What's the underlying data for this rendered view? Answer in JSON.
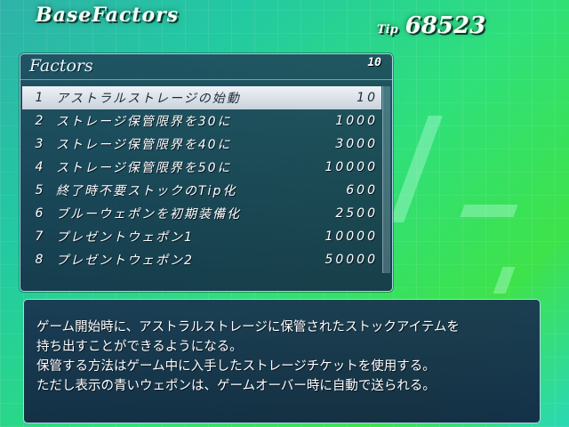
{
  "header": {
    "title": "BaseFactors",
    "tip_label": "Tip",
    "tip_value": "68523"
  },
  "factors_panel": {
    "title": "Factors",
    "count": "10",
    "selected_index": 0,
    "items": [
      {
        "num": "1",
        "name": "アストラルストレージの始動",
        "cost": "10"
      },
      {
        "num": "2",
        "name": "ストレージ保管限界を30に",
        "cost": "1000"
      },
      {
        "num": "3",
        "name": "ストレージ保管限界を40に",
        "cost": "3000"
      },
      {
        "num": "4",
        "name": "ストレージ保管限界を50に",
        "cost": "10000"
      },
      {
        "num": "5",
        "name": "終了時不要ストックのTip化",
        "cost": "600"
      },
      {
        "num": "6",
        "name": "ブルーウェポンを初期装備化",
        "cost": "2500"
      },
      {
        "num": "7",
        "name": "プレゼントウェポン1",
        "cost": "10000"
      },
      {
        "num": "8",
        "name": "プレゼントウェポン2",
        "cost": "50000"
      }
    ]
  },
  "description": {
    "lines": [
      "ゲーム開始時に、アストラルストレージに保管されたストックアイテムを",
      "持ち出すことができるようになる。",
      "保管する方法はゲーム中に入手したストレージチケットを使用する。",
      "ただし表示の青いウェポンは、ゲームオーバー時に自動で送られる。"
    ]
  },
  "colors": {
    "background": "#2fe07a",
    "panel": "#1e4660",
    "panel_border": "#a9d8e6",
    "selected_row": "#e6ebf0"
  }
}
